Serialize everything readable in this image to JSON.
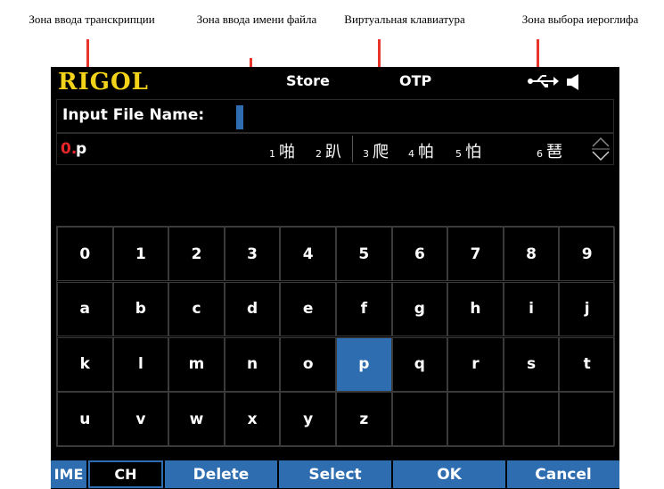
{
  "annotations": [
    "Зона ввода транскрипции",
    "Зона ввода имени файла",
    "Виртуальная клавиатура",
    "Зона выбора иероглифа"
  ],
  "topbar": {
    "logo": "RIGOL",
    "title": "Store",
    "mode": "OTP"
  },
  "filename": {
    "label": "Input File Name:",
    "value": ""
  },
  "pinyin": {
    "index": "0.",
    "text": "p",
    "candidates": [
      {
        "num": "1",
        "char": "啪"
      },
      {
        "num": "2",
        "char": "趴"
      },
      {
        "num": "3",
        "char": "爬"
      },
      {
        "num": "4",
        "char": "帕"
      },
      {
        "num": "5",
        "char": "怕"
      },
      {
        "num": "6",
        "char": "琶"
      }
    ]
  },
  "keyboard": {
    "rows": [
      [
        "0",
        "1",
        "2",
        "3",
        "4",
        "5",
        "6",
        "7",
        "8",
        "9"
      ],
      [
        "a",
        "b",
        "c",
        "d",
        "e",
        "f",
        "g",
        "h",
        "i",
        "j"
      ],
      [
        "k",
        "l",
        "m",
        "n",
        "o",
        "p",
        "q",
        "r",
        "s",
        "t"
      ],
      [
        "u",
        "v",
        "w",
        "x",
        "y",
        "z",
        "",
        "",
        "",
        ""
      ]
    ],
    "selected": "p"
  },
  "softkeys": {
    "ime_label": "IME",
    "ime_mode": "CH",
    "delete": "Delete",
    "select": "Select",
    "ok": "OK",
    "cancel": "Cancel"
  },
  "colors": {
    "accent": "#2d6db0",
    "logo": "#f3d21a",
    "index": "#e8262a",
    "arrow": "#e8342a"
  }
}
